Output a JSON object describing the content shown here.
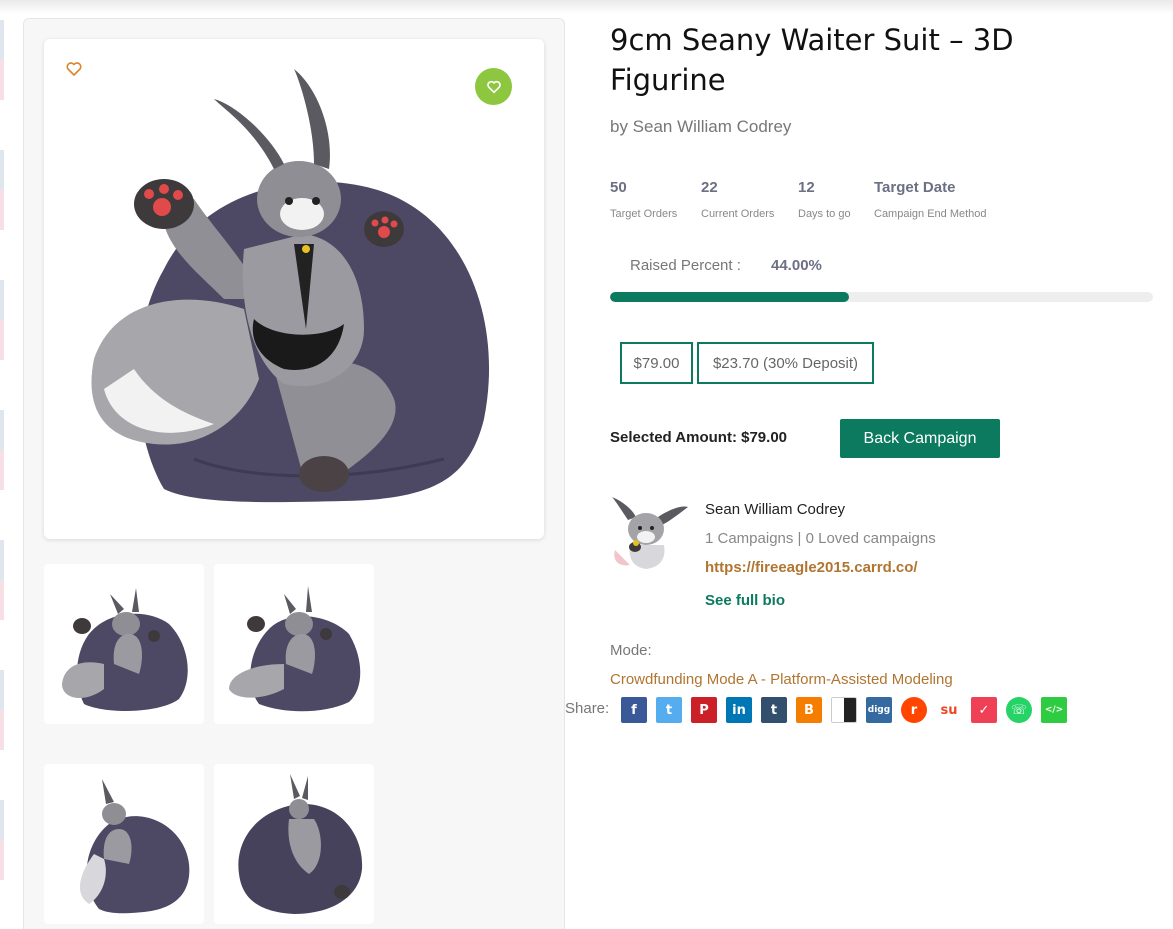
{
  "product": {
    "title": "9cm Seany Waiter Suit – 3D Figurine",
    "byline": "by Sean William Codrey"
  },
  "stats": [
    {
      "value": "50",
      "label": "Target Orders"
    },
    {
      "value": "22",
      "label": "Current Orders"
    },
    {
      "value": "12",
      "label": "Days to go"
    },
    {
      "value": "Target Date",
      "label": "Campaign End Method"
    }
  ],
  "raised": {
    "label": "Raised Percent :",
    "value": "44.00%",
    "fraction": 0.44
  },
  "pricing": {
    "full": "$79.00",
    "deposit": "$23.70 (30% Deposit)",
    "selected": "Selected Amount: $79.00",
    "back_label": "Back Campaign"
  },
  "creator": {
    "name": "Sean William Codrey",
    "stats": "1 Campaigns | 0 Loved campaigns",
    "link": "https://fireeagle2015.carrd.co/",
    "bio_label": "See full bio"
  },
  "mode": {
    "label": "Mode:",
    "value": "Crowdfunding Mode A - Platform-Assisted Modeling"
  },
  "share": {
    "label": "Share:",
    "icons": [
      {
        "name": "facebook-icon",
        "glyph": "f",
        "color": "#3b5998"
      },
      {
        "name": "twitter-icon",
        "glyph": "t",
        "color": "#55acee"
      },
      {
        "name": "pinterest-icon",
        "glyph": "P",
        "color": "#cb2027"
      },
      {
        "name": "linkedin-icon",
        "glyph": "in",
        "color": "#0077b5"
      },
      {
        "name": "tumblr-icon",
        "glyph": "t",
        "color": "#32506d"
      },
      {
        "name": "blogger-icon",
        "glyph": "B",
        "color": "#f57d00"
      },
      {
        "name": "delicious-icon",
        "glyph": "",
        "color": "#3399ff"
      },
      {
        "name": "digg-icon",
        "glyph": "digg",
        "color": "#356aa0"
      },
      {
        "name": "reddit-icon",
        "glyph": "r",
        "color": "#ff4500"
      },
      {
        "name": "stumbleupon-icon",
        "glyph": "su",
        "color": "#eb4924"
      },
      {
        "name": "pocket-icon",
        "glyph": "✓",
        "color": "#ef4056"
      },
      {
        "name": "whatsapp-icon",
        "glyph": "☏",
        "color": "#25d366"
      },
      {
        "name": "embed-icon",
        "glyph": "</>",
        "color": "#2ecc40"
      }
    ]
  },
  "colors": {
    "accent": "#0c7a5e",
    "link": "#b07530",
    "favorite": "#8dc63f"
  }
}
